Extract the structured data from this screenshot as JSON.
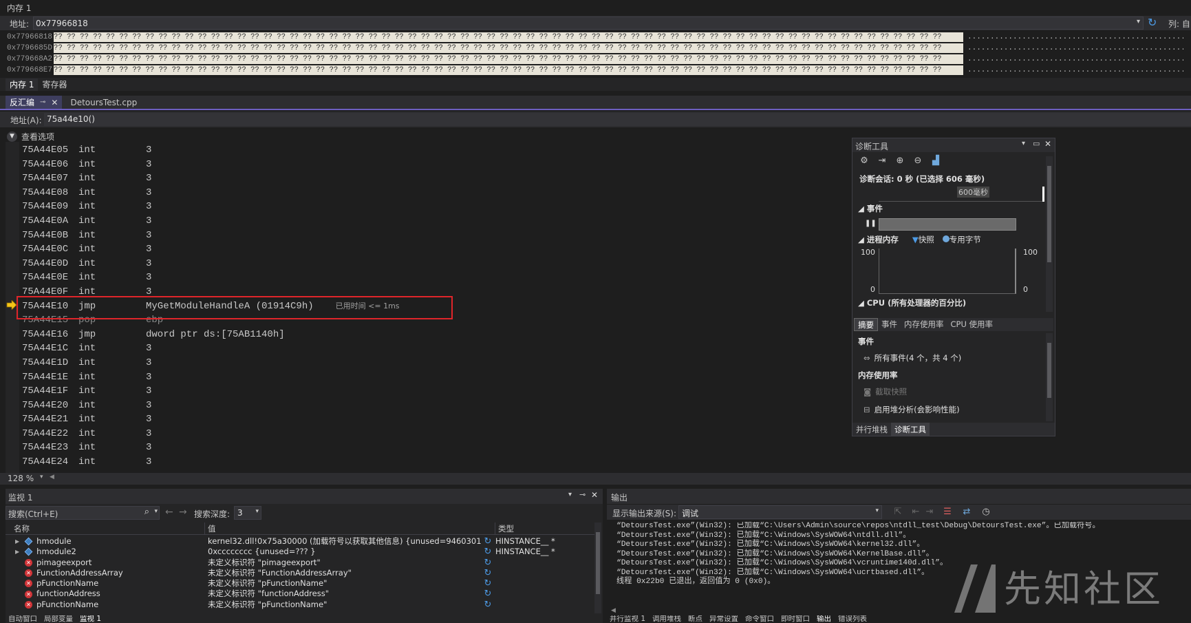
{
  "memory": {
    "title": "内存 1",
    "address_label": "地址:",
    "address_value": "0x77966818",
    "col_label": "列: 自",
    "rows": [
      {
        "addr": "0x77966818",
        "hex": "?? ?? ?? ?? ?? ?? ?? ?? ?? ?? ?? ?? ?? ?? ?? ?? ?? ?? ?? ?? ?? ?? ?? ?? ?? ?? ?? ?? ?? ?? ?? ?? ?? ?? ?? ?? ?? ?? ?? ?? ?? ?? ?? ?? ?? ?? ?? ?? ?? ?? ?? ?? ?? ?? ?? ?? ?? ?? ?? ?? ?? ?? ?? ?? ?? ?? ?? ??",
        "ascii": "................................................................................"
      },
      {
        "addr": "0x7796685D",
        "hex": "?? ?? ?? ?? ?? ?? ?? ?? ?? ?? ?? ?? ?? ?? ?? ?? ?? ?? ?? ?? ?? ?? ?? ?? ?? ?? ?? ?? ?? ?? ?? ?? ?? ?? ?? ?? ?? ?? ?? ?? ?? ?? ?? ?? ?? ?? ?? ?? ?? ?? ?? ?? ?? ?? ?? ?? ?? ?? ?? ?? ?? ?? ?? ?? ?? ?? ?? ??",
        "ascii": "................................................................................"
      },
      {
        "addr": "0x779668A2",
        "hex": "?? ?? ?? ?? ?? ?? ?? ?? ?? ?? ?? ?? ?? ?? ?? ?? ?? ?? ?? ?? ?? ?? ?? ?? ?? ?? ?? ?? ?? ?? ?? ?? ?? ?? ?? ?? ?? ?? ?? ?? ?? ?? ?? ?? ?? ?? ?? ?? ?? ?? ?? ?? ?? ?? ?? ?? ?? ?? ?? ?? ?? ?? ?? ?? ?? ?? ?? ??",
        "ascii": "................................................................................"
      },
      {
        "addr": "0x779668E7",
        "hex": "?? ?? ?? ?? ?? ?? ?? ?? ?? ?? ?? ?? ?? ?? ?? ?? ?? ?? ?? ?? ?? ?? ?? ?? ?? ?? ?? ?? ?? ?? ?? ?? ?? ?? ?? ?? ?? ?? ?? ?? ?? ?? ?? ?? ?? ?? ?? ?? ?? ?? ?? ?? ?? ?? ?? ?? ?? ?? ?? ?? ?? ?? ?? ?? ?? ?? ?? ??",
        "ascii": "................................................................................"
      }
    ],
    "tabs": [
      "内存 1",
      "寄存器"
    ]
  },
  "editor_tabs": {
    "active": "反汇编",
    "other": "DetoursTest.cpp"
  },
  "disasm": {
    "address_label": "地址(A):",
    "address_value": "75a44e10()",
    "view_options": "查看选项",
    "zoom": "128 %",
    "rows": [
      {
        "addr": "75A44E05",
        "mn": "int",
        "op": "3"
      },
      {
        "addr": "75A44E06",
        "mn": "int",
        "op": "3"
      },
      {
        "addr": "75A44E07",
        "mn": "int",
        "op": "3"
      },
      {
        "addr": "75A44E08",
        "mn": "int",
        "op": "3"
      },
      {
        "addr": "75A44E09",
        "mn": "int",
        "op": "3"
      },
      {
        "addr": "75A44E0A",
        "mn": "int",
        "op": "3"
      },
      {
        "addr": "75A44E0B",
        "mn": "int",
        "op": "3"
      },
      {
        "addr": "75A44E0C",
        "mn": "int",
        "op": "3"
      },
      {
        "addr": "75A44E0D",
        "mn": "int",
        "op": "3"
      },
      {
        "addr": "75A44E0E",
        "mn": "int",
        "op": "3"
      },
      {
        "addr": "75A44E0F",
        "mn": "int",
        "op": "3"
      },
      {
        "addr": "75A44E10",
        "mn": "jmp",
        "op": "MyGetModuleHandleA (01914C9h)",
        "elapsed": "已用时间 <= 1ms"
      },
      {
        "addr": "75A44E15",
        "mn": "pop",
        "op": "ebp"
      },
      {
        "addr": "75A44E16",
        "mn": "jmp",
        "op": "dword ptr ds:[75AB1140h]"
      },
      {
        "addr": "75A44E1C",
        "mn": "int",
        "op": "3"
      },
      {
        "addr": "75A44E1D",
        "mn": "int",
        "op": "3"
      },
      {
        "addr": "75A44E1E",
        "mn": "int",
        "op": "3"
      },
      {
        "addr": "75A44E1F",
        "mn": "int",
        "op": "3"
      },
      {
        "addr": "75A44E20",
        "mn": "int",
        "op": "3"
      },
      {
        "addr": "75A44E21",
        "mn": "int",
        "op": "3"
      },
      {
        "addr": "75A44E22",
        "mn": "int",
        "op": "3"
      },
      {
        "addr": "75A44E23",
        "mn": "int",
        "op": "3"
      },
      {
        "addr": "75A44E24",
        "mn": "int",
        "op": "3"
      }
    ]
  },
  "diagnostics": {
    "title": "诊断工具",
    "session": "诊断会话: 0 秒 (已选择 606 毫秒)",
    "timeline_label": "600毫秒",
    "events_header": "事件",
    "process_memory": "进程内存",
    "legend_snapshot": "快照",
    "legend_private": "专用字节",
    "y_max_left": "100",
    "y_min_left": "0",
    "y_max_right": "100",
    "y_min_right": "0",
    "cpu_header": "CPU (所有处理器的百分比)",
    "cpu_y_left": "100",
    "cpu_y_right": "100",
    "tabs": [
      "摘要",
      "事件",
      "内存使用率",
      "CPU 使用率"
    ],
    "section_events": "事件",
    "all_events": "所有事件(4 个，共 4 个)",
    "section_memory": "内存使用率",
    "take_snapshot": "截取快照",
    "heap_analysis": "启用堆分析(会影响性能)",
    "bottom_tabs": [
      "并行堆栈",
      "诊断工具"
    ],
    "colors": {
      "snapshot": "#4d9be6",
      "private_bytes": "#6fa8dc"
    }
  },
  "watch": {
    "title": "监视 1",
    "search_placeholder": "搜索(Ctrl+E)",
    "depth_label": "搜索深度:",
    "depth_value": "3",
    "col_name": "名称",
    "col_value": "值",
    "col_type": "类型",
    "rows": [
      {
        "icon": "cube",
        "name": "hmodule",
        "value": "kernel32.dll!0x75a30000 (加载符号以获取其他信息) {unused=9460301 }",
        "type": "HINSTANCE__ *"
      },
      {
        "icon": "cube",
        "name": "hmodule2",
        "value": "0xcccccccc {unused=??? }",
        "type": "HINSTANCE__ *"
      },
      {
        "icon": "error",
        "name": "pimageexport",
        "value": "未定义标识符 \"pimageexport\"",
        "type": ""
      },
      {
        "icon": "error",
        "name": "FunctionAddressArray",
        "value": "未定义标识符 \"FunctionAddressArray\"",
        "type": ""
      },
      {
        "icon": "error",
        "name": "pFunctionName",
        "value": "未定义标识符 \"pFunctionName\"",
        "type": ""
      },
      {
        "icon": "error",
        "name": "functionAddress",
        "value": "未定义标识符 \"functionAddress\"",
        "type": ""
      },
      {
        "icon": "error",
        "name": "pFunctionName",
        "value": "未定义标识符 \"pFunctionName\"",
        "type": ""
      }
    ],
    "bottom_tabs": [
      "自动窗口",
      "局部变量",
      "监视 1"
    ]
  },
  "output": {
    "title": "输出",
    "source_label": "显示输出来源(S):",
    "source_value": "调试",
    "lines": [
      "“DetoursTest.exe”(Win32): 已加载“C:\\Users\\Admin\\source\\repos\\ntdll_test\\Debug\\DetoursTest.exe”。已加载符号。",
      "“DetoursTest.exe”(Win32): 已加载“C:\\Windows\\SysWOW64\\ntdll.dll”。",
      "“DetoursTest.exe”(Win32): 已加载“C:\\Windows\\SysWOW64\\kernel32.dll”。",
      "“DetoursTest.exe”(Win32): 已加载“C:\\Windows\\SysWOW64\\KernelBase.dll”。",
      "“DetoursTest.exe”(Win32): 已加载“C:\\Windows\\SysWOW64\\vcruntime140d.dll”。",
      "“DetoursTest.exe”(Win32): 已加载“C:\\Windows\\SysWOW64\\ucrtbased.dll”。",
      "线程 0x22b0 已退出，返回值为 0 (0x0)。"
    ],
    "bottom_tabs": [
      "并行监视 1",
      "调用堆栈",
      "断点",
      "异常设置",
      "命令窗口",
      "即时窗口",
      "输出",
      "错误列表"
    ]
  },
  "watermark": "先知社区"
}
